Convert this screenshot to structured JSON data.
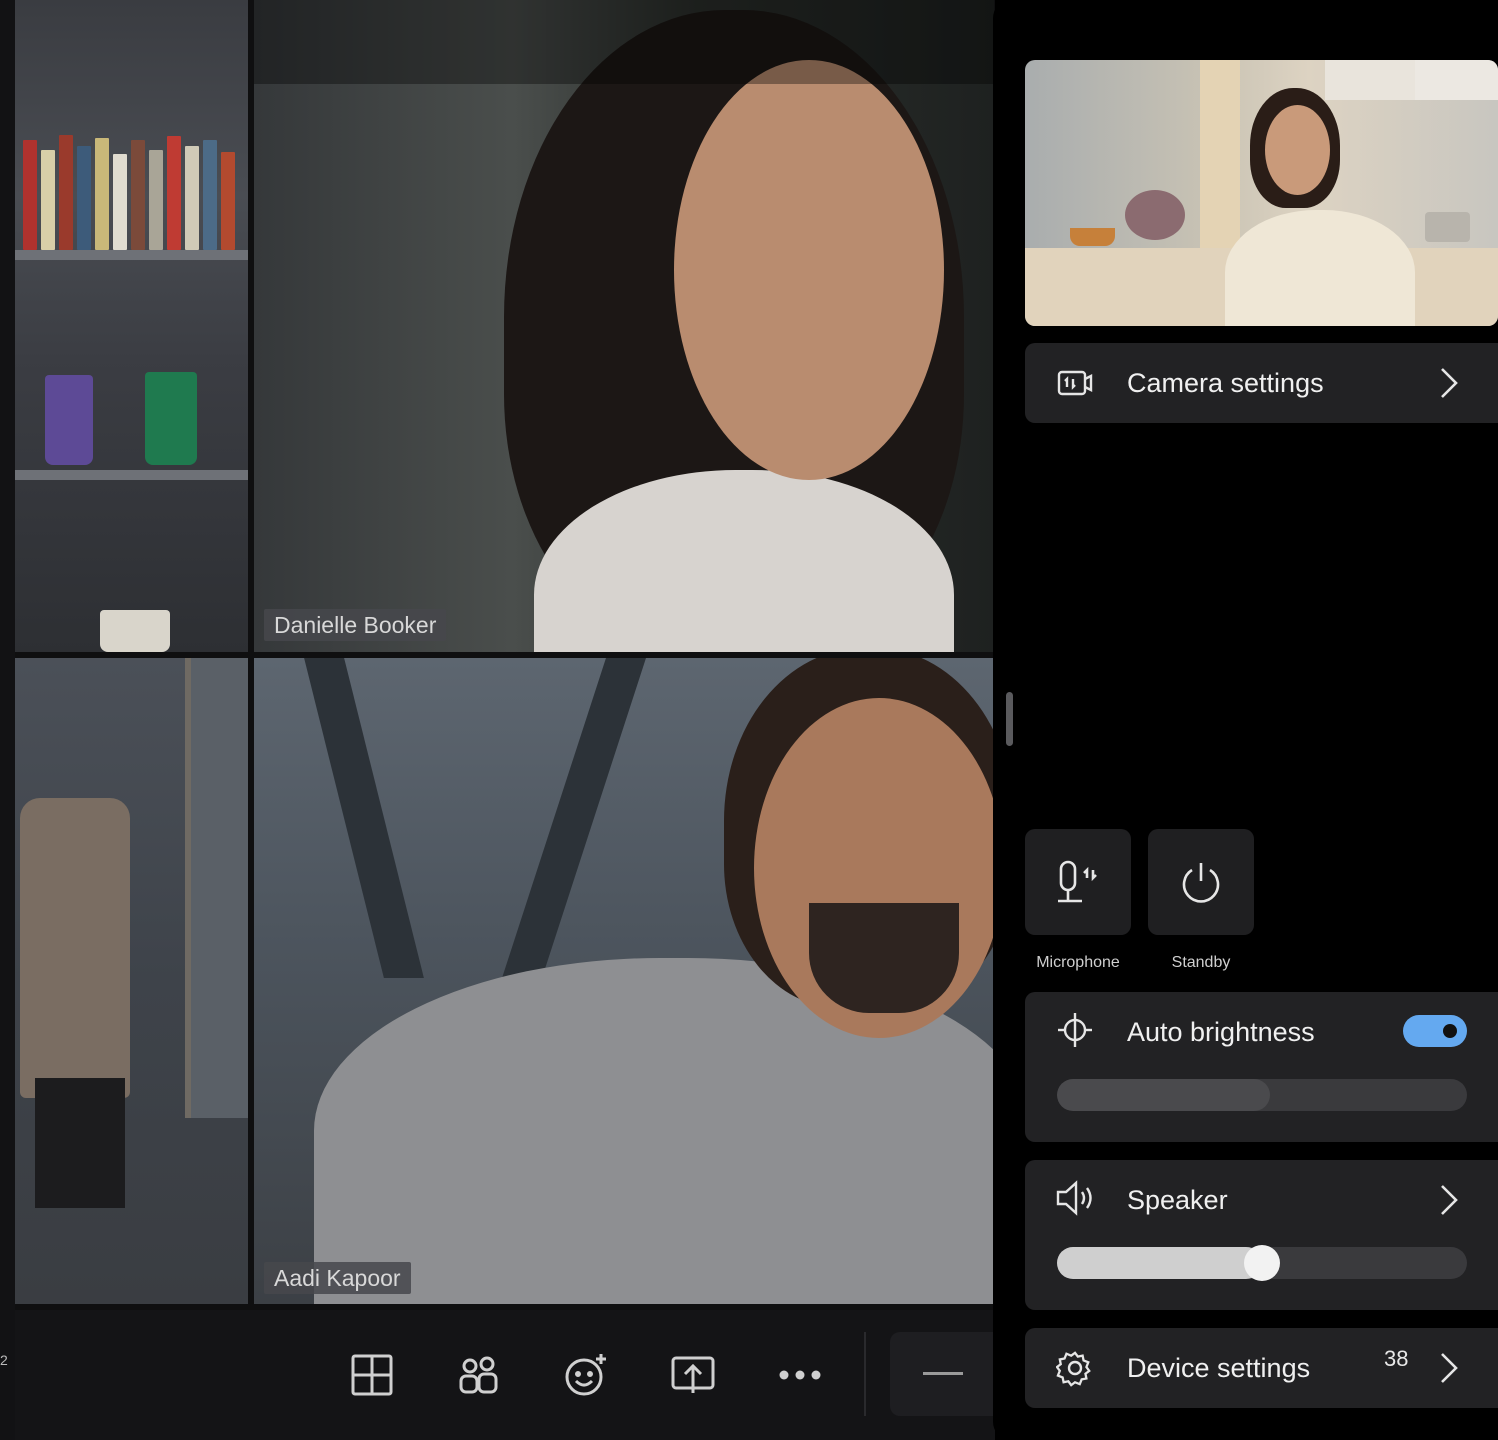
{
  "participants": [
    {
      "name": "Danielle Booker"
    },
    {
      "name": "Aadi Kapoor"
    }
  ],
  "edge_label": "2",
  "toolbar": {
    "buttons": [
      {
        "icon": "layout-grid-icon"
      },
      {
        "icon": "participants-icon"
      },
      {
        "icon": "add-reaction-icon"
      },
      {
        "icon": "share-screen-icon"
      },
      {
        "icon": "more-options-icon"
      },
      {
        "icon": "minimize-icon"
      }
    ]
  },
  "panel": {
    "camera_settings": {
      "label": "Camera settings",
      "icon": "camera-icon"
    },
    "quick_buttons": [
      {
        "label": "Microphone",
        "icon": "microphone-icon"
      },
      {
        "label": "Standby",
        "icon": "power-icon"
      }
    ],
    "brightness": {
      "label": "Auto brightness",
      "icon": "brightness-icon",
      "auto": true,
      "level": 0.52
    },
    "speaker": {
      "label": "Speaker",
      "icon": "speaker-icon",
      "level": 0.5
    },
    "device_settings": {
      "label": "Device settings",
      "icon": "gear-icon",
      "count": "38"
    }
  },
  "colors": {
    "accent": "#64a9f0",
    "panel_card": "#222224"
  }
}
